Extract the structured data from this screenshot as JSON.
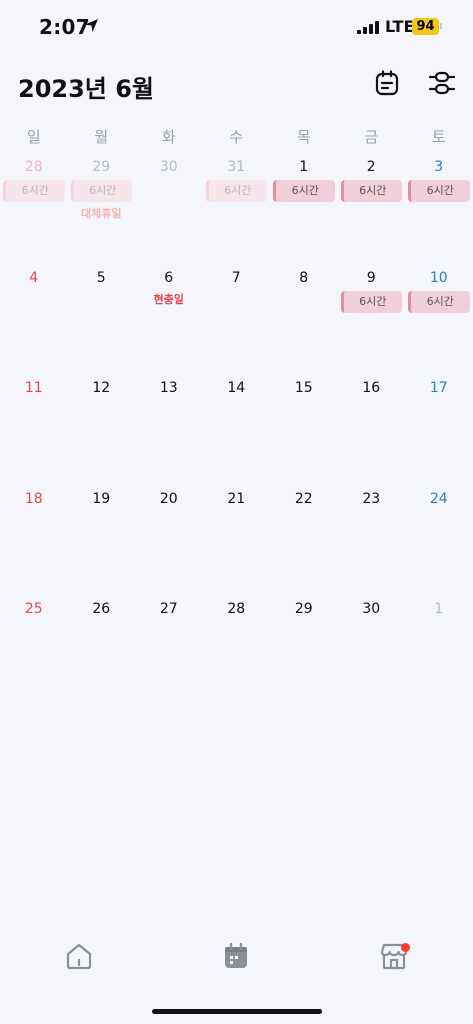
{
  "status": {
    "time": "2:07",
    "network": "LTE",
    "battery": "94"
  },
  "header": {
    "title": "2023년 6월"
  },
  "weekdays": [
    "일",
    "월",
    "화",
    "수",
    "목",
    "금",
    "토"
  ],
  "rows": [
    [
      {
        "day": "28",
        "faded": true,
        "event": "6시간"
      },
      {
        "day": "29",
        "faded": true,
        "event": "6시간",
        "holiday": "대체휴일"
      },
      {
        "day": "30",
        "faded": true
      },
      {
        "day": "31",
        "faded": true,
        "event": "6시간"
      },
      {
        "day": "1",
        "event": "6시간"
      },
      {
        "day": "2",
        "event": "6시간"
      },
      {
        "day": "3",
        "event": "6시간"
      }
    ],
    [
      {
        "day": "4"
      },
      {
        "day": "5"
      },
      {
        "day": "6",
        "holiday": "현충일"
      },
      {
        "day": "7"
      },
      {
        "day": "8"
      },
      {
        "day": "9",
        "event": "6시간"
      },
      {
        "day": "10",
        "event": "6시간"
      }
    ],
    [
      {
        "day": "11"
      },
      {
        "day": "12"
      },
      {
        "day": "13"
      },
      {
        "day": "14"
      },
      {
        "day": "15"
      },
      {
        "day": "16"
      },
      {
        "day": "17"
      }
    ],
    [
      {
        "day": "18"
      },
      {
        "day": "19"
      },
      {
        "day": "20"
      },
      {
        "day": "21"
      },
      {
        "day": "22"
      },
      {
        "day": "23"
      },
      {
        "day": "24"
      }
    ],
    [
      {
        "day": "25"
      },
      {
        "day": "26"
      },
      {
        "day": "27"
      },
      {
        "day": "28"
      },
      {
        "day": "29"
      },
      {
        "day": "30"
      },
      {
        "day": "1",
        "faded": true
      }
    ]
  ],
  "colors": {
    "sunday": "#e5484d",
    "saturday": "#2a7fc4",
    "event_bg": "#f2d0db",
    "event_bar": "#e48ca0"
  },
  "nav": {
    "items": [
      {
        "name": "home",
        "icon": "home-icon"
      },
      {
        "name": "calendar",
        "icon": "calendar-icon",
        "active": true
      },
      {
        "name": "store",
        "icon": "store-icon"
      }
    ]
  }
}
